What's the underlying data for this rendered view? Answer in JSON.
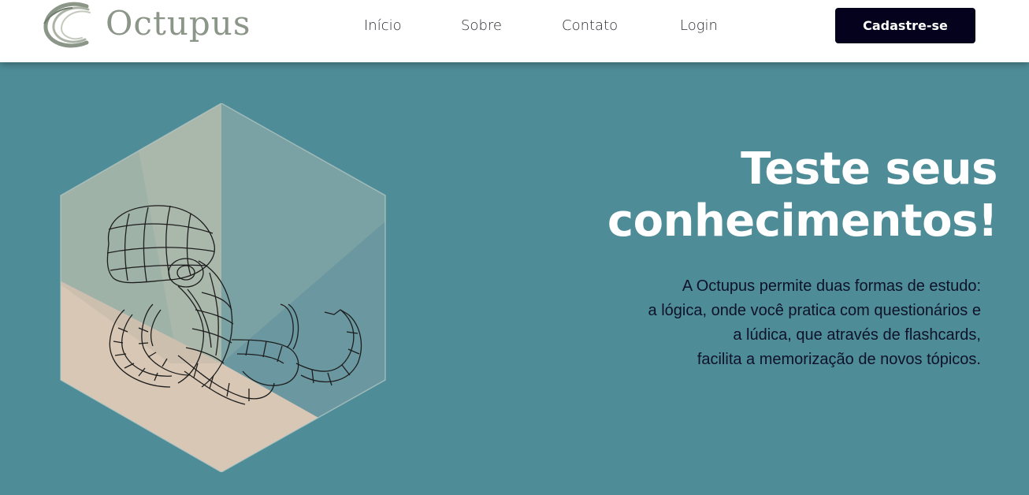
{
  "header": {
    "logo_text": "Octupus",
    "nav": {
      "inicio": "Início",
      "sobre": "Sobre",
      "contato": "Contato",
      "login": "Login"
    },
    "cta_label": "Cadastre-se"
  },
  "hero": {
    "title_line1": "Teste seus",
    "title_line2": "conhecimentos!",
    "description": [
      "A Octupus permite duas formas de estudo:",
      "a lógica, onde você pratica com questionários e",
      "a lúdica, que através de flashcards,",
      "facilita a memorização de novos tópicos."
    ]
  },
  "colors": {
    "hero_background": "#4e8c97",
    "header_background": "#ffffff",
    "cta_background": "#04021d",
    "title_text": "#ffffff",
    "description_text": "#0e1229",
    "logo_text": "#8b9688"
  },
  "icons": {
    "logo": "octopus-tentacle-swirl-logo",
    "hero_image": "wireframe-octopus-in-hexagon"
  }
}
